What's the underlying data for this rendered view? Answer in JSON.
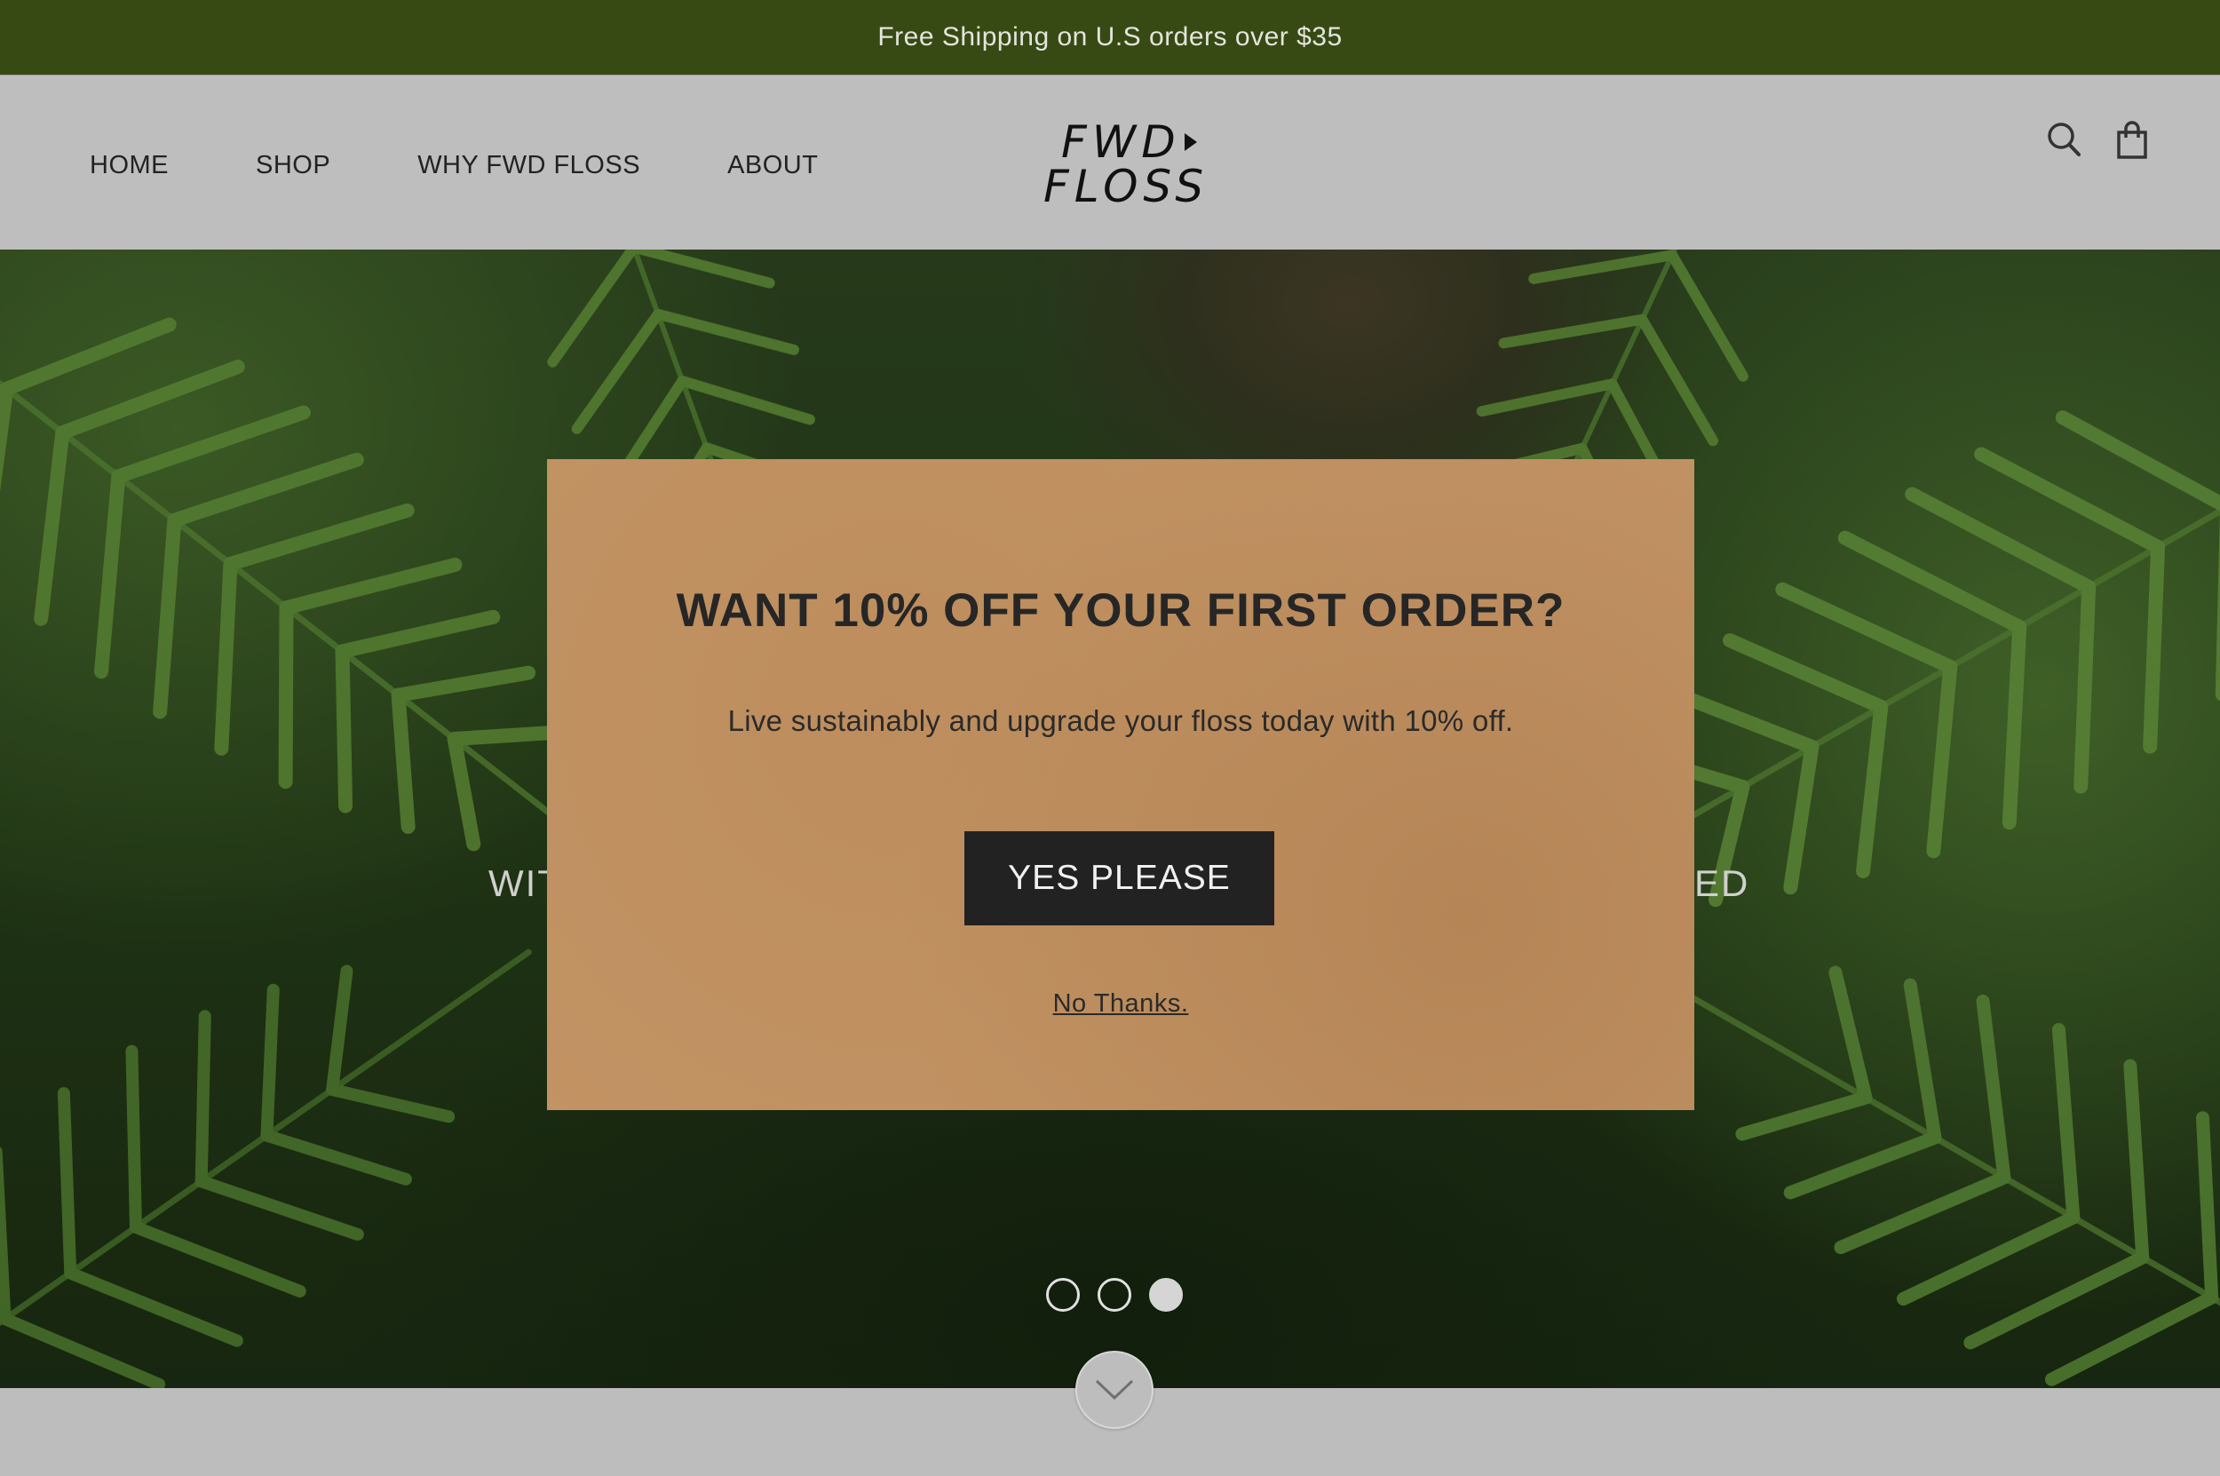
{
  "announcement": "Free Shipping on U.S orders over $35",
  "nav": {
    "home": "HOME",
    "shop": "SHOP",
    "why": "WHY FWD FLOSS",
    "about": "ABOUT"
  },
  "logo": {
    "line1": "FWD",
    "line2": "FLOSS"
  },
  "hero": {
    "text_left": "WIT",
    "text_right": "ED",
    "slides_total": 3,
    "active_slide": 3
  },
  "modal": {
    "title": "WANT 10% OFF YOUR FIRST ORDER?",
    "subtitle": "Live sustainably and upgrade your floss today with 10% off.",
    "yes_label": "YES PLEASE",
    "no_label": "No Thanks."
  },
  "icons": {
    "search": "search-icon",
    "bag": "shopping-bag-icon",
    "scroll": "chevron-down-icon"
  },
  "colors": {
    "announcement_bg": "#374a14",
    "header_bg": "#bebebe",
    "modal_bg": "#c29364",
    "button_bg": "#222222"
  }
}
